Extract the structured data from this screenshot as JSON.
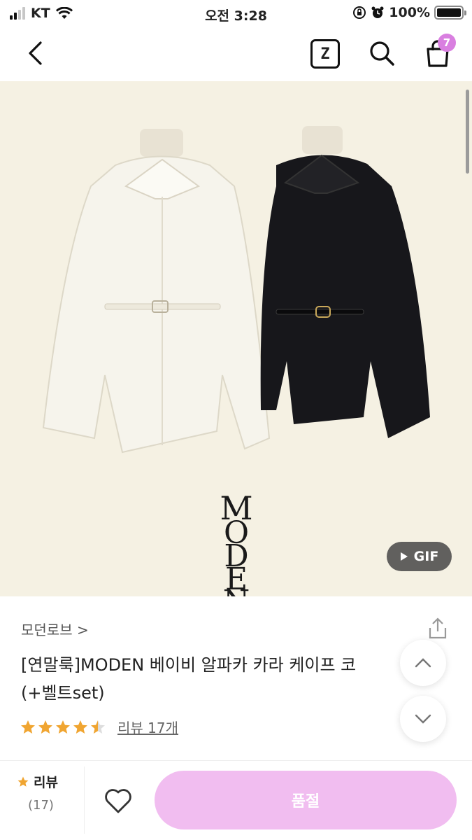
{
  "status_bar": {
    "carrier": "KT",
    "time": "오전 3:28",
    "battery": "100%"
  },
  "header": {
    "z_label": "Z",
    "cart_count": "7",
    "icons": [
      "back-icon",
      "z-icon",
      "search-icon",
      "cart-icon"
    ]
  },
  "product_image": {
    "brand_watermark": "MODEN",
    "gif_label": "GIF"
  },
  "product": {
    "brand": "모던로브 >",
    "title_line1": "[연말룩]MODEN 베이비 알파카 카라 케이프 코",
    "title_line2": "(+벨트set)",
    "rating": 4.5,
    "rating_max": 5,
    "review_link": "리뷰 17개"
  },
  "bottom_bar": {
    "review_label": "리뷰",
    "review_count": "(17)",
    "action_label": "품절"
  },
  "colors": {
    "accent": "#f1bdf0",
    "badge": "#d97fe0",
    "star": "#f0a531",
    "image_bg": "#f5f1e3"
  }
}
